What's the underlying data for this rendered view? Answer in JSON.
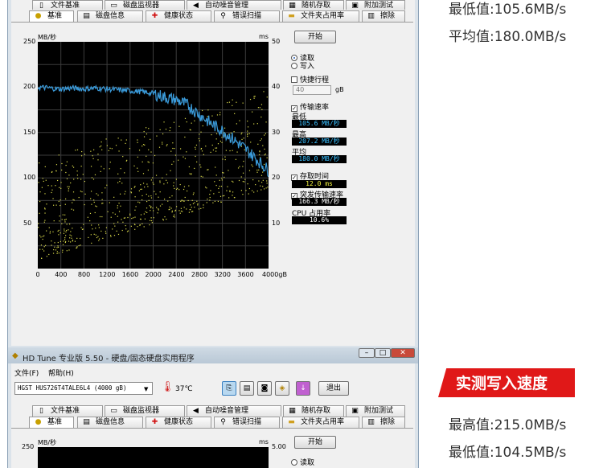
{
  "top_window": {
    "tabs_row1": [
      {
        "label": "文件基准",
        "icon": "file-icon"
      },
      {
        "label": "磁盘监视器",
        "icon": "monitor-icon"
      },
      {
        "label": "自动噪音管理",
        "icon": "speaker-icon"
      },
      {
        "label": "随机存取",
        "icon": "random-access-icon"
      },
      {
        "label": "附加测试",
        "icon": "extra-test-icon"
      }
    ],
    "tabs_row2": [
      {
        "label": "基准",
        "icon": "benchmark-icon"
      },
      {
        "label": "磁盘信息",
        "icon": "disk-info-icon"
      },
      {
        "label": "健康状态",
        "icon": "health-icon"
      },
      {
        "label": "错误扫描",
        "icon": "error-scan-icon"
      },
      {
        "label": "文件夹占用率",
        "icon": "folder-icon"
      },
      {
        "label": "擦除",
        "icon": "erase-icon"
      }
    ],
    "start_button": "开始",
    "read_label": "读取",
    "write_label": "写入",
    "quick_stroke_label": "快捷行程",
    "quick_stroke_value": "40",
    "gb_unit": "gB",
    "transfer_rate_label": "传输速率",
    "min_label": "最低",
    "min_value": "105.6 MB/秒",
    "max_label": "最高",
    "max_value": "207.2 MB/秒",
    "avg_label": "平均",
    "avg_value": "180.0 MB/秒",
    "access_time_label": "存取时间",
    "access_time_value": "12.0 ms",
    "burst_rate_label": "突发传输速率",
    "burst_rate_value": "166.3 MB/秒",
    "cpu_label": "CPU 占用率",
    "cpu_value": "10.6%"
  },
  "chart_data": {
    "type": "line",
    "y_left_unit": "MB/秒",
    "y_right_unit": "ms",
    "y_left_ticks": [
      "250",
      "200",
      "150",
      "100",
      "50"
    ],
    "y_right_ticks": [
      "50",
      "40",
      "30",
      "20",
      "10"
    ],
    "x_ticks": [
      "0",
      "400",
      "800",
      "1200",
      "1600",
      "2000",
      "2400",
      "2800",
      "3200",
      "3600",
      "4000gB"
    ],
    "ylim_left": [
      0,
      250
    ],
    "ylim_right": [
      0,
      50
    ],
    "xlim": [
      0,
      4000
    ],
    "series": [
      {
        "name": "传输速率",
        "color": "#3a9ad9",
        "x": [
          0,
          200,
          400,
          600,
          800,
          1000,
          1200,
          1400,
          1600,
          1800,
          2000,
          2200,
          2400,
          2600,
          2800,
          3000,
          3200,
          3400,
          3600,
          3800,
          4000
        ],
        "y": [
          200,
          199,
          198,
          199,
          198,
          199,
          198,
          197,
          196,
          195,
          193,
          189,
          186,
          180,
          170,
          160,
          152,
          142,
          132,
          120,
          108
        ]
      },
      {
        "name": "存取时间",
        "color": "#d8d84a",
        "type": "scatter",
        "x_range": [
          0,
          4000
        ],
        "y_min_start": 2,
        "y_max_start": 24,
        "y_min_end": 18,
        "y_max_end": 40
      }
    ]
  },
  "bottom_window": {
    "title": "HD Tune 专业版 5.50 - 硬盘/固态硬盘实用程序",
    "menu_file": "文件(F)",
    "menu_help": "帮助(H)",
    "drive": "HGST HUS726T4TALE6L4 (4000 gB)",
    "temperature": "37℃",
    "exit_button": "退出",
    "tabs_row1": [
      {
        "label": "文件基准",
        "icon": "file-icon"
      },
      {
        "label": "磁盘监视器",
        "icon": "monitor-icon"
      },
      {
        "label": "自动噪音管理",
        "icon": "speaker-icon"
      },
      {
        "label": "随机存取",
        "icon": "random-access-icon"
      },
      {
        "label": "附加测试",
        "icon": "extra-test-icon"
      }
    ],
    "tabs_row2": [
      {
        "label": "基准",
        "icon": "benchmark-icon"
      },
      {
        "label": "磁盘信息",
        "icon": "disk-info-icon"
      },
      {
        "label": "健康状态",
        "icon": "health-icon"
      },
      {
        "label": "错误扫描",
        "icon": "error-scan-icon"
      },
      {
        "label": "文件夹占用率",
        "icon": "folder-icon"
      },
      {
        "label": "擦除",
        "icon": "erase-icon"
      }
    ],
    "y_top_left": "250",
    "y_unit_left": "MB/秒",
    "y_unit_right": "ms",
    "y_top_right": "5.00",
    "start_button": "开始",
    "read_label": "读取"
  },
  "right_panel": {
    "read_min": "最低值:105.6MB/s",
    "read_avg": "平均值:180.0MB/s",
    "write_banner": "实测写入速度",
    "write_max": "最高值:215.0MB/s",
    "write_min": "最低值:104.5MB/s"
  },
  "colors": {
    "banner_red": "#e01818",
    "chart_bg": "#000000",
    "line_blue": "#3a9ad9",
    "scatter_yellow": "#d8d84a"
  }
}
